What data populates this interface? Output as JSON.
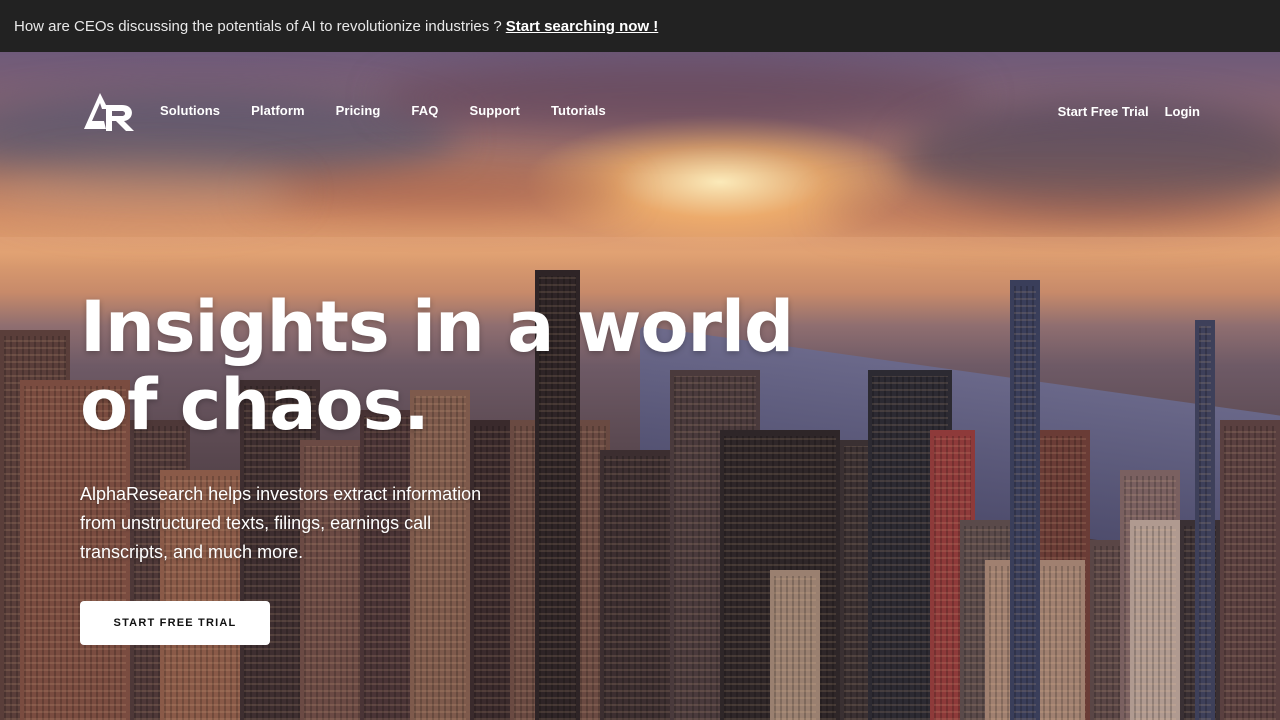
{
  "banner": {
    "text": "How are CEOs discussing the potentials of AI to revolutionize industries ?",
    "link_label": "Start searching now !"
  },
  "nav": {
    "logo_icon": "alpharesearch-logo",
    "links": [
      "Solutions",
      "Platform",
      "Pricing",
      "FAQ",
      "Support",
      "Tutorials"
    ],
    "trial_label": "Start Free Trial",
    "login_label": "Login"
  },
  "hero": {
    "headline_line1": "Insights in a world",
    "headline_line2": "of chaos.",
    "subtext": "AlphaResearch helps investors extract information from unstructured texts, filings, earnings call transcripts, and much more.",
    "cta_label": "START FREE TRIAL",
    "background": "city-skyline-sunset-photo"
  },
  "colors": {
    "banner_bg": "#222222",
    "text": "#ffffff",
    "cta_bg": "#ffffff",
    "cta_text": "#111111"
  }
}
